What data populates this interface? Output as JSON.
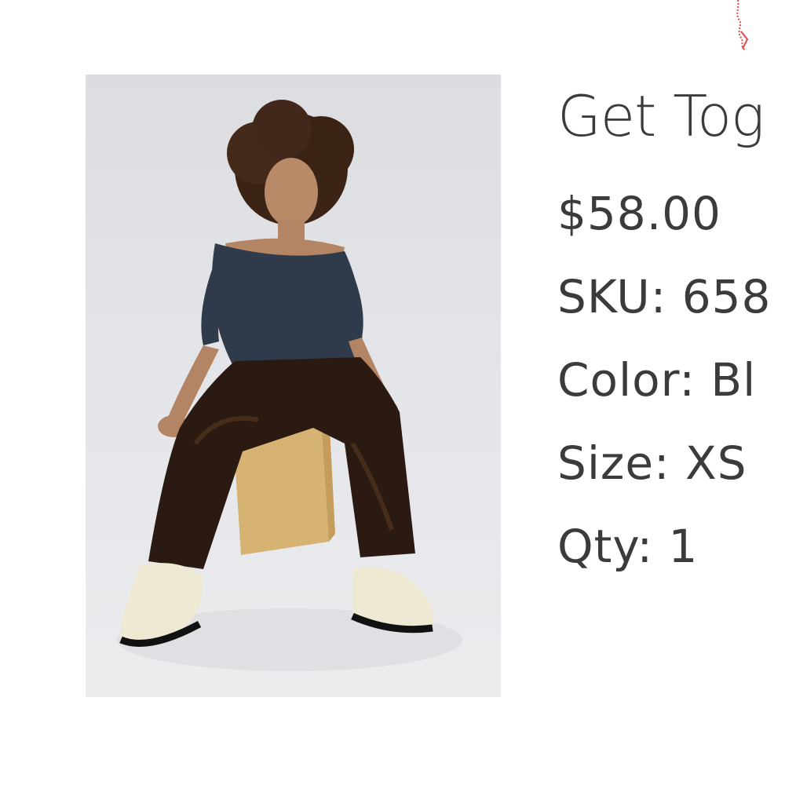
{
  "product": {
    "title": "Get Tog",
    "price": "$58.00",
    "sku_label": "SKU:",
    "sku_value": "658",
    "color_label": "Color:",
    "color_value": "Bl",
    "size_label": "Size:",
    "size_value": "XS",
    "qty_label": "Qty:",
    "qty_value": "1"
  },
  "image": {
    "description": "product-photo",
    "colors": {
      "background": "#e2e3e7",
      "top": "#2f3b4a",
      "pants": "#2a1a12",
      "block": "#d9b574",
      "shoes": "#eee9d2"
    }
  }
}
